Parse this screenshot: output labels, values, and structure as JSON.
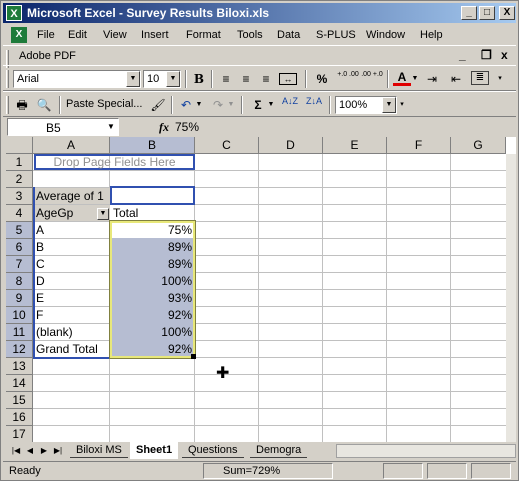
{
  "window": {
    "title": "Microsoft Excel - Survey Results Biloxi.xls",
    "app_icon": "excel-icon",
    "controls": {
      "minimize": "_",
      "maximize": "□",
      "close": "X"
    }
  },
  "menubar": {
    "items": [
      "File",
      "Edit",
      "View",
      "Insert",
      "Format",
      "Tools",
      "Data",
      "S-PLUS",
      "Window",
      "Help"
    ],
    "right_controls": {
      "minimize": "_",
      "restore": "❐",
      "close": "x"
    }
  },
  "pdfbar": {
    "label": "Adobe PDF"
  },
  "formatting_toolbar": {
    "font": "Arial",
    "size": "10",
    "bold": "B",
    "percent": "%",
    "inc_decimal": "+.0 .00",
    "dec_decimal": ".00 +.0",
    "font_color_letter": "A",
    "accent_font_color": "#e00000"
  },
  "standard_toolbar": {
    "paste_special": "Paste Special...",
    "sum": "Σ",
    "zoom": "100%"
  },
  "formula_bar": {
    "name_box": "B5",
    "fx": "fx",
    "value": "75%"
  },
  "grid": {
    "columns": [
      "A",
      "B",
      "C",
      "D",
      "E",
      "F",
      "G"
    ],
    "selected_column": "B",
    "rows": [
      "1",
      "2",
      "3",
      "4",
      "5",
      "6",
      "7",
      "8",
      "9",
      "10",
      "11",
      "12",
      "13",
      "14",
      "15",
      "16",
      "17"
    ],
    "selected_rows": [
      "5",
      "6",
      "7",
      "8",
      "9",
      "10",
      "11",
      "12"
    ],
    "pivot": {
      "drop_zone": "Drop Page Fields Here",
      "data_label": "Average of 1",
      "row_field": "AgeGp",
      "col_header": "Total",
      "rows": [
        {
          "label": "A",
          "value": "75%"
        },
        {
          "label": "B",
          "value": "89%"
        },
        {
          "label": "C",
          "value": "89%"
        },
        {
          "label": "D",
          "value": "100%"
        },
        {
          "label": "E",
          "value": "93%"
        },
        {
          "label": "F",
          "value": "92%"
        },
        {
          "label": "(blank)",
          "value": "100%"
        },
        {
          "label": "Grand Total",
          "value": "92%"
        }
      ]
    }
  },
  "sheet_tabs": {
    "tabs": [
      "Biloxi MS",
      "Sheet1",
      "Questions",
      "Demogra"
    ],
    "active": "Sheet1"
  },
  "status": {
    "left": "Ready",
    "sum": "Sum=729%"
  }
}
